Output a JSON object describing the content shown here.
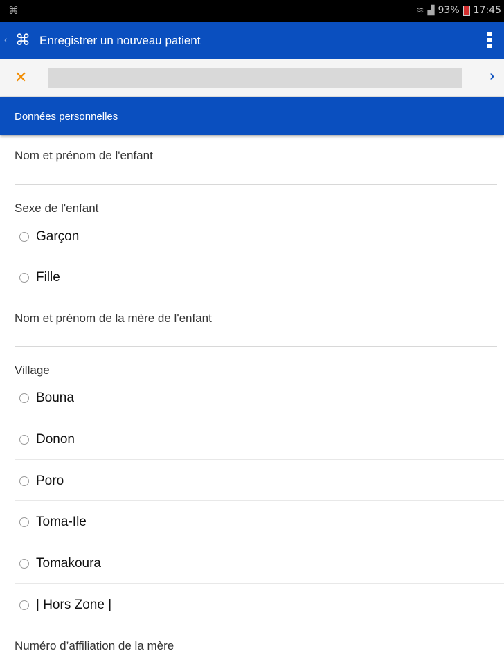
{
  "status_bar": {
    "battery": "93%",
    "time": "17:45"
  },
  "app_bar": {
    "title": "Enregistrer un nouveau patient"
  },
  "section": {
    "title": "Données personnelles"
  },
  "form": {
    "child_name_label": "Nom et prénom de l'enfant",
    "sex_label": "Sexe de l'enfant",
    "sex_options": [
      "Garçon",
      "Fille"
    ],
    "mother_name_label": "Nom et prénom de la mère de l'enfant",
    "village_label": "Village",
    "village_options": [
      "Bouna",
      "Donon",
      "Poro",
      "Toma-Ile",
      "Tomakoura",
      "| Hors Zone |"
    ],
    "affiliation_label": "Numéro d’affiliation de la mère"
  },
  "colors": {
    "primary": "#0a4fbf",
    "accent": "#f28c00"
  }
}
